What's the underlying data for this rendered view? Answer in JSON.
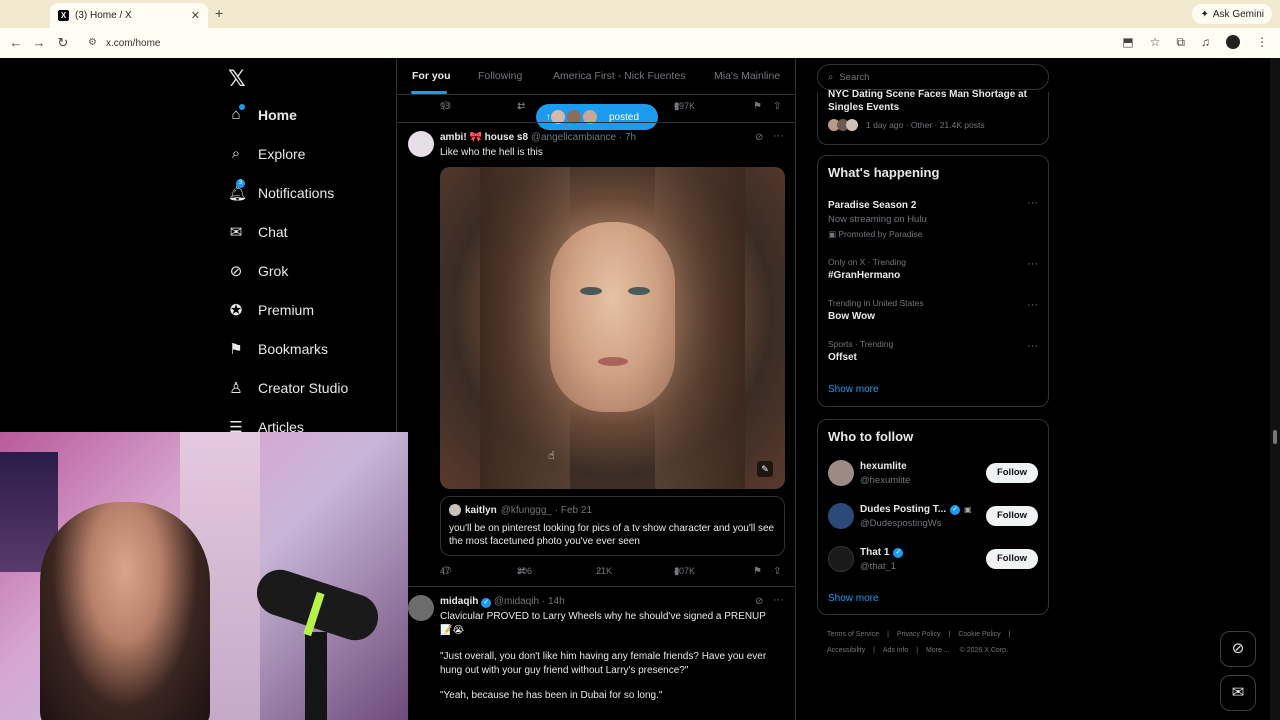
{
  "browser": {
    "tab_title": "(3) Home / X",
    "new_tab": "+",
    "tab_close": "✕",
    "url": "x.com/home",
    "ask_gemini": "Ask Gemini"
  },
  "nav": {
    "logo": "𝕏",
    "items": [
      {
        "label": "Home",
        "icon": "home-icon"
      },
      {
        "label": "Explore",
        "icon": "search-icon"
      },
      {
        "label": "Notifications",
        "icon": "bell-icon",
        "badge": "3"
      },
      {
        "label": "Chat",
        "icon": "mail-icon"
      },
      {
        "label": "Grok",
        "icon": "grok-icon"
      },
      {
        "label": "Premium",
        "icon": "premium-icon"
      },
      {
        "label": "Bookmarks",
        "icon": "bookmark-icon"
      },
      {
        "label": "Creator Studio",
        "icon": "creator-icon"
      },
      {
        "label": "Articles",
        "icon": "article-icon"
      }
    ]
  },
  "feed": {
    "tabs": [
      "For you",
      "Following",
      "America First - Nick Fuentes",
      "Mia's Mainline"
    ],
    "top_actions": {
      "replies": "93",
      "reposts": "1",
      "views": "697K"
    },
    "pill_label": "posted",
    "tweet1": {
      "name": "ambi! 🎀 house s8",
      "handle": "@angelicambiance · 7h",
      "text": "Like who the hell is this",
      "quote": {
        "name": "kaitlyn",
        "handle": "@kfunggg_ · Feb 21",
        "text": "you'll be on pinterest looking for pics of a tv show character and you'll see the most facetuned photo you've ever seen"
      },
      "actions": {
        "replies": "47",
        "reposts": "306",
        "likes": "21K",
        "views": "407K"
      }
    },
    "tweet2": {
      "name": "midaqih",
      "handle": "@midaqih · 14h",
      "text": "Clavicular PROVED to Larry Wheels why he should've signed a PRENUP 📝😭",
      "para2": "\"Just overall, you don't like him having any female friends? Have you ever hung out with your guy friend without Larry's presence?\"",
      "para3": "\"Yeah, because he has been in Dubai for so long.\""
    }
  },
  "sidebar": {
    "search_placeholder": "Search",
    "top_story": {
      "title": "NYC Dating Scene Faces Man Shortage at Singles Events",
      "meta": "1 day ago · Other · 21.4K posts"
    },
    "happening": {
      "heading": "What's happening",
      "trends": [
        {
          "title": "Paradise Season 2",
          "sub": "Now streaming on Hulu",
          "meta2": "Promoted by Paradise"
        },
        {
          "meta": "Only on X · Trending",
          "title": "#GranHermano"
        },
        {
          "meta": "Trending in United States",
          "title": "Bow Wow"
        },
        {
          "meta": "Sports · Trending",
          "title": "Offset"
        }
      ],
      "show_more": "Show more"
    },
    "who_to_follow": {
      "heading": "Who to follow",
      "users": [
        {
          "name": "hexumlite",
          "handle": "@hexumlite"
        },
        {
          "name": "Dudes Posting T...",
          "handle": "@DudespostingWs"
        },
        {
          "name": "That 1",
          "handle": "@that_1"
        }
      ],
      "follow_label": "Follow",
      "show_more": "Show more"
    },
    "footer": [
      "Terms of Service",
      "Privacy Policy",
      "Cookie Policy",
      "Accessibility",
      "Ads info",
      "More ...",
      "© 2026 X Corp."
    ]
  }
}
